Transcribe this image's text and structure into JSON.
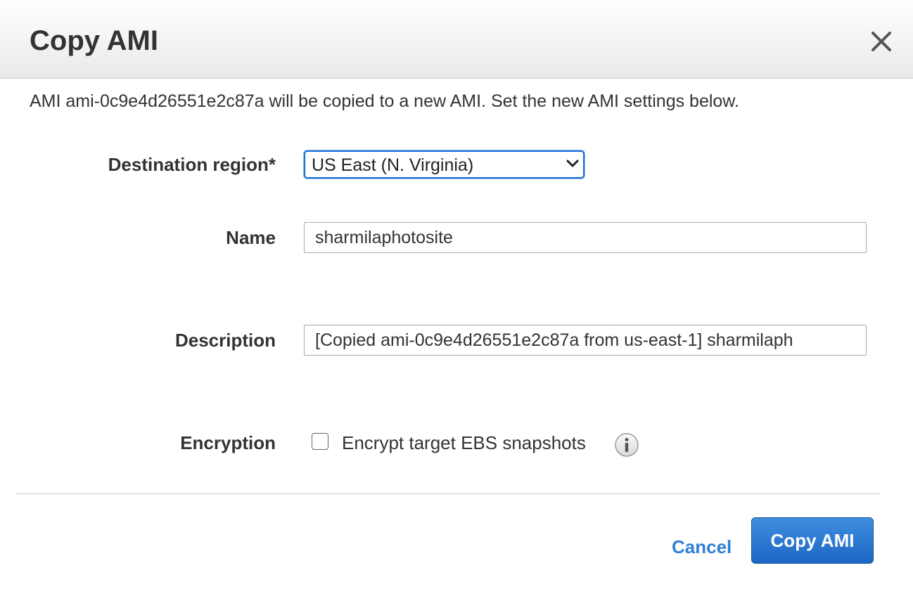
{
  "dialog": {
    "title": "Copy AMI",
    "close_icon": "close-icon",
    "intro_text": "AMI ami-0c9e4d26551e2c87a will be copied to a new AMI. Set the new AMI settings below."
  },
  "form": {
    "destination_region": {
      "label": "Destination region*",
      "selected": "US East (N. Virginia)"
    },
    "name": {
      "label": "Name",
      "value": "sharmilaphotosite"
    },
    "description": {
      "label": "Description",
      "value": "[Copied ami-0c9e4d26551e2c87a from us-east-1] sharmilaph"
    },
    "encryption": {
      "label": "Encryption",
      "checkbox_label": "Encrypt target EBS snapshots",
      "checked": false,
      "info_icon": "info-icon"
    }
  },
  "footer": {
    "cancel_label": "Cancel",
    "submit_label": "Copy AMI"
  },
  "colors": {
    "primary_button": "#1b66c4",
    "link": "#2f7fd6",
    "focus_border": "#1a6fd8"
  }
}
